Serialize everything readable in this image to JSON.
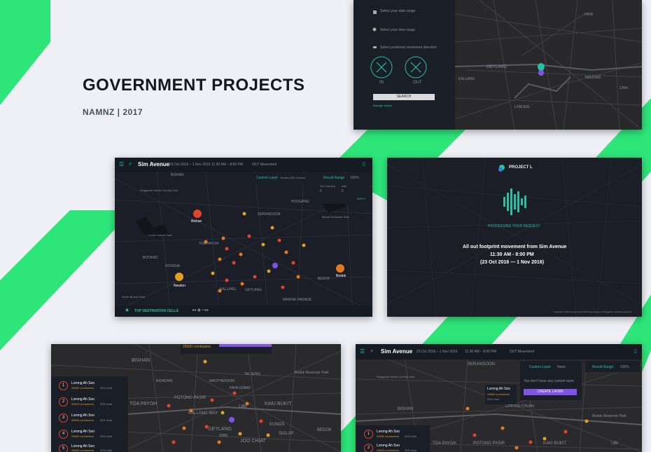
{
  "page": {
    "title": "GOVERNMENT PROJECTS",
    "subtitle": "NAMNZ | 2017",
    "colors": {
      "background": "#eef0f6",
      "accent_green": "#2ee57a",
      "teal": "#25c0a6",
      "purple": "#7d54e6",
      "dark_ui": "#1a1e27"
    }
  },
  "shot1": {
    "date_label": "Select your date range",
    "time_label": "Select your time range",
    "movement_label": "Select preferred movement direction",
    "in_label": "IN",
    "out_label": "OUT",
    "search_label": "SEARCH",
    "link_label": "Manage results",
    "map_labels": [
      "GEYLANG",
      "LORONG",
      "KALLANG",
      "TANJONG",
      "PAYA",
      "CHAI"
    ]
  },
  "shot2": {
    "app_title": "Sim Avenue",
    "date_range": "23 Oct 2016 – 1 Nov 2016",
    "time_range": "11:30 AM – 8:00 PM",
    "movement": "OUT Movement",
    "custom_layer_label": "Custom Layer",
    "layer_value": "Yerram (Sth Choice)",
    "result_range_label": "Result Range",
    "result_range_value": "100%",
    "range_from_label": "Set Cutoff to",
    "range_from_value": "0",
    "range_to_label": "with",
    "range_to_value": "0",
    "apply_label": "APPLY",
    "places": [
      "Bishan",
      "Newton",
      "Bedok"
    ],
    "map_labels": [
      "Singapore Island Country Club",
      "Bedok Reservoir Park",
      "BISHAN",
      "TOA PAYOH",
      "BOTANIC",
      "NOVENA",
      "GEYLANG",
      "KALLANG",
      "SERANGOON",
      "HOUGANG",
      "BEDOK",
      "MARINE PARADE",
      "Lornie Nature Park",
      "South Buona Vista"
    ],
    "bottom_label": "TOP DESTINATION CELLS"
  },
  "shot3": {
    "project": "PROJECT L",
    "status": "PROCESSING YOUR REQUEST",
    "line1": "All out footprint movement from Sim Avenue",
    "line2": "11:30 AM - 8:00 PM",
    "line3": "(23 Oct 2016 — 1 Nov 2016)",
    "footer": "Copyright © 2016 Government Technology Agency of Singapore. All rights reserved."
  },
  "shot4": {
    "tooltip_count": "26500 commuters",
    "ranks": [
      {
        "num": "1",
        "name": "Lorong Ah Soo",
        "count": "26500 commuters",
        "pct": "30% total"
      },
      {
        "num": "2",
        "name": "Lorong Ah Soo",
        "count": "26500 commuters",
        "pct": "30% total"
      },
      {
        "num": "3",
        "name": "Lorong Ah Soo",
        "count": "26500 commuters",
        "pct": "30% total"
      },
      {
        "num": "4",
        "name": "Lorong Ah Soo",
        "count": "26500 commuters",
        "pct": "30% total"
      },
      {
        "num": "5",
        "name": "Lorong Ah Soo",
        "count": "26500 commuters",
        "pct": "30% total"
      }
    ],
    "map_labels": [
      "BISHAN",
      "TOA PAYOH",
      "POTONG PASIR",
      "KALLANG WAY",
      "GEYLANG",
      "JOO CHIAT",
      "BEDOK",
      "Bedok Reservoir Park",
      "KAKI BUKIT",
      "UBI",
      "SIMS",
      "EUNOS",
      "SIGLAP",
      "PAYA LEBAR",
      "MACPHERSON",
      "TAI SENG",
      "BIDADARI"
    ]
  },
  "shot5": {
    "app_title": "Sim Avenue",
    "date_range": "23 Oct 2016 – 1 Nov 2016",
    "time_range": "11:30 AM – 8:00 PM",
    "movement": "OUT Movement",
    "custom_layer_label": "Custom Layer",
    "layer_value": "None",
    "result_range_label": "Result Range",
    "result_range_value": "100%",
    "empty_message": "You don't have any custom layer.",
    "create_label": "CREATE LAYER",
    "tooltip_name": "Lorong Ah Soo",
    "tooltip_count": "26500 commuters",
    "tooltip_pct": "30% total",
    "ranks": [
      {
        "num": "1",
        "name": "Lorong Ah Soo",
        "count": "26500 commuters",
        "pct": "30% total"
      },
      {
        "num": "2",
        "name": "Lorong Ah Soo",
        "count": "26500 commuters",
        "pct": "30% total"
      }
    ],
    "map_labels": [
      "Singapore Island Country Club",
      "Bedok Reservoir Park",
      "SERANGOON",
      "LORONG CHUAN",
      "KAKI BUKIT",
      "TOA PAYOH",
      "POTONG PASIR",
      "BISHAN",
      "UBI"
    ]
  }
}
